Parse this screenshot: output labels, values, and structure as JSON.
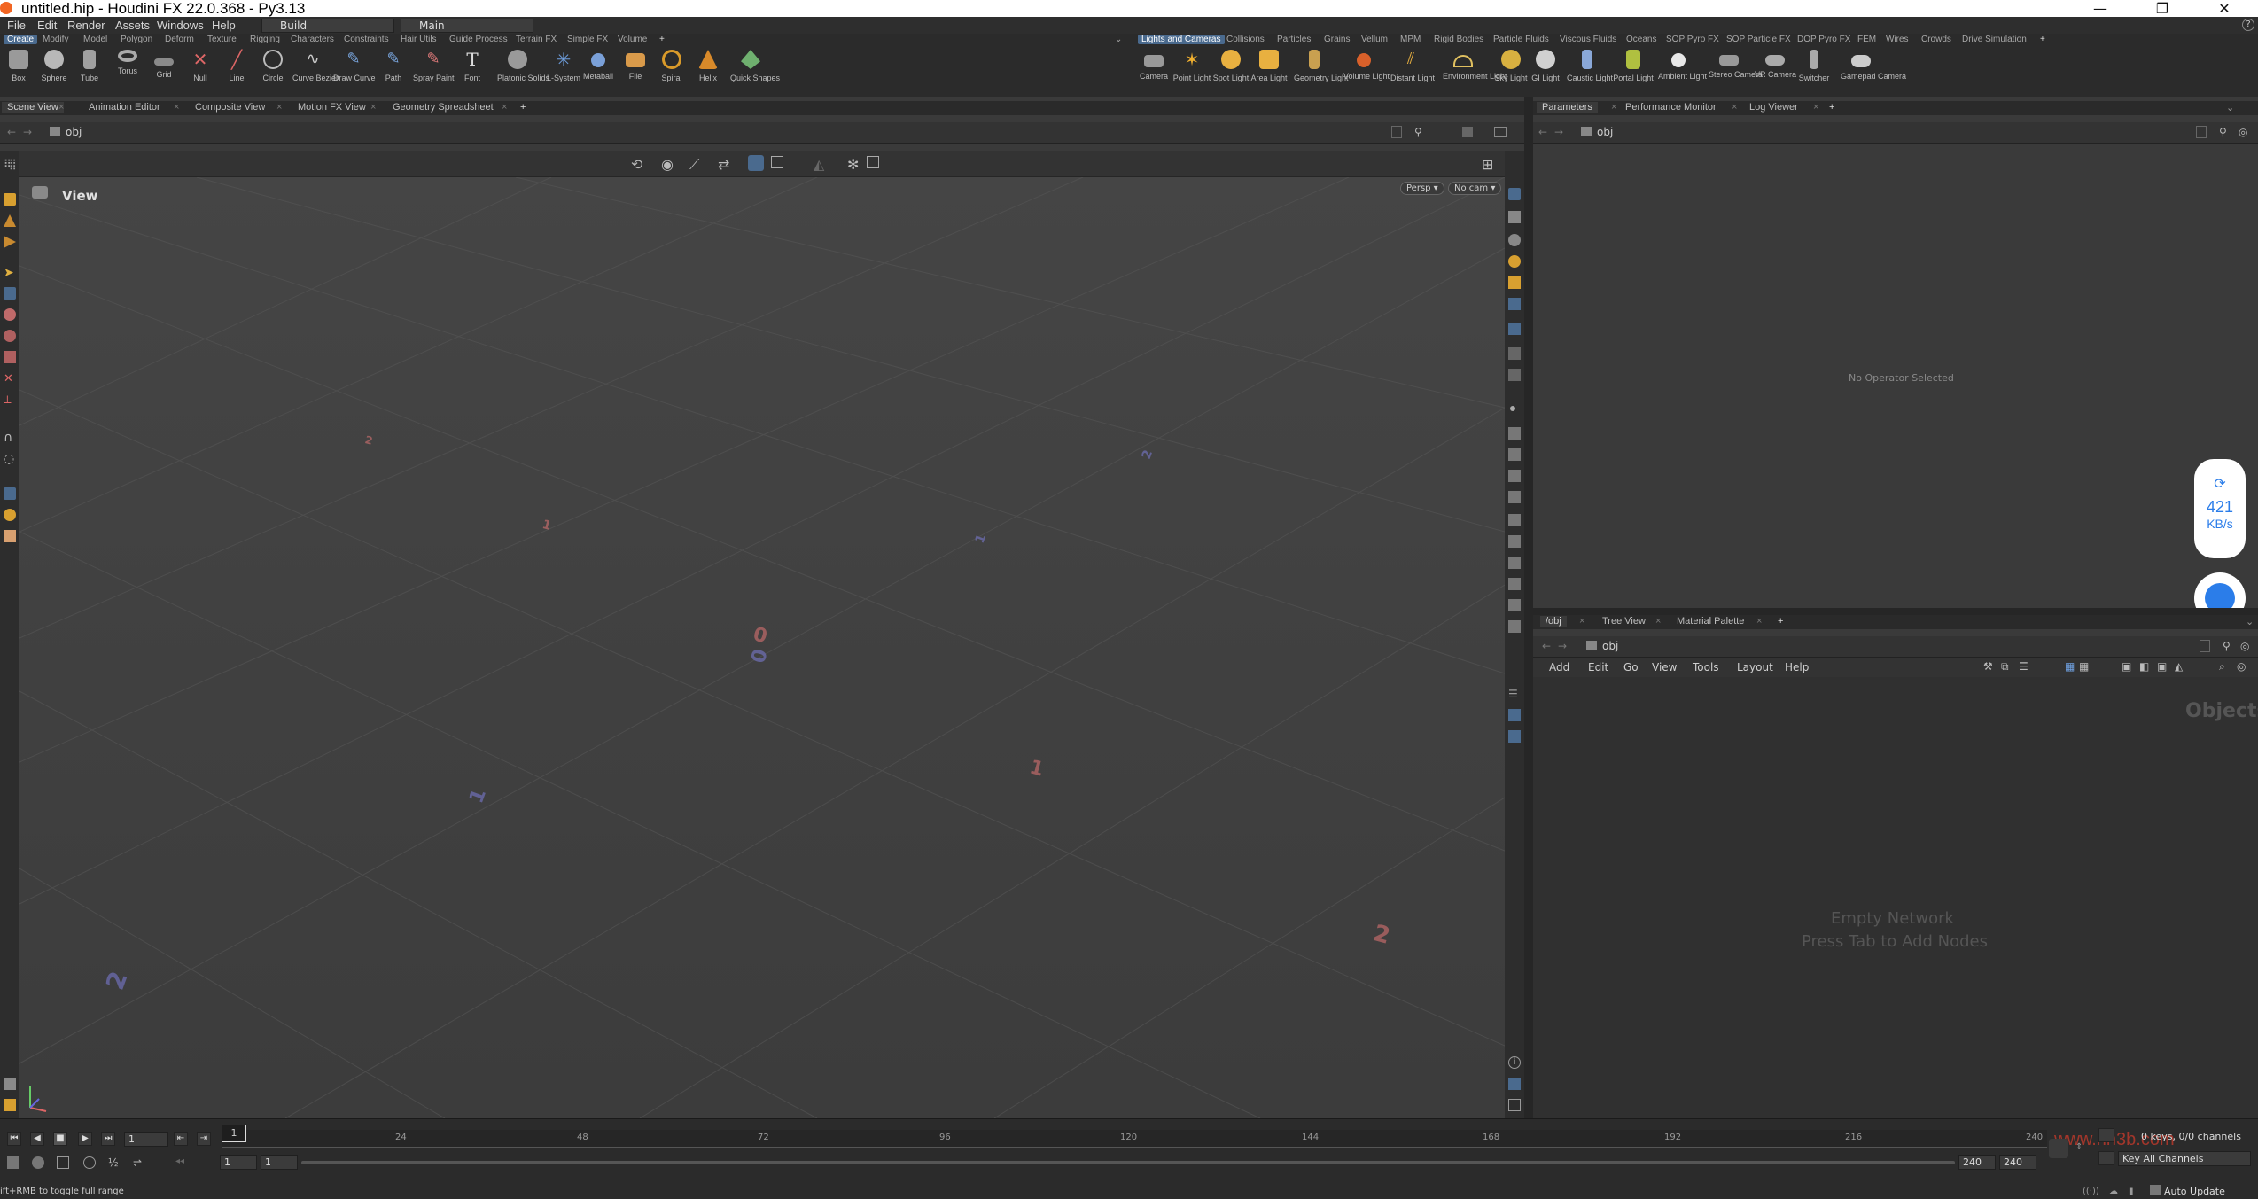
{
  "window": {
    "title": "untitled.hip - Houdini FX 22.0.368 - Py3.13",
    "controls": [
      "—",
      "❐",
      "✕"
    ]
  },
  "menubar": {
    "items": [
      "File",
      "Edit",
      "Render",
      "Assets",
      "Windows",
      "Help"
    ],
    "desktop_combo": "Build",
    "context_combo": "Main"
  },
  "shelf_left": {
    "tabs": [
      "Create",
      "Modify",
      "Model",
      "Polygon",
      "Deform",
      "Texture",
      "Rigging",
      "Characters",
      "Hair Utils",
      "Guide Process",
      "Terrain FX",
      "Simple FX",
      "Volume"
    ],
    "active_tab": "Create",
    "tools": [
      "Box",
      "Sphere",
      "Tube",
      "Torus",
      "Grid",
      "Null",
      "Line",
      "Circle",
      "Curve Bezier",
      "Draw Curve",
      "Path",
      "Spray Paint",
      "Font",
      "Platonic Solids",
      "L-System",
      "Metaball",
      "File",
      "Spiral",
      "Helix",
      "Quick Shapes"
    ]
  },
  "shelf_right": {
    "tabs": [
      "Lights and Cameras",
      "Collisions",
      "Particles",
      "Grains",
      "Vellum",
      "MPM",
      "Rigid Bodies",
      "Particle Fluids",
      "Viscous Fluids",
      "Oceans",
      "SOP Pyro FX",
      "SOP Particle FX",
      "DOP Pyro FX",
      "FEM",
      "Wires",
      "Crowds",
      "Drive Simulation"
    ],
    "active_tab": "Lights and Cameras",
    "tools": [
      "Camera",
      "Point Light",
      "Spot Light",
      "Area Light",
      "Geometry Light",
      "Volume Light",
      "Distant Light",
      "Environment Light",
      "Sky Light",
      "GI Light",
      "Caustic Light",
      "Portal Light",
      "Ambient Light",
      "Stereo Camera",
      "VR Camera",
      "Switcher",
      "Gamepad Camera"
    ]
  },
  "left_pane": {
    "tabs": [
      "Scene View",
      "Animation Editor",
      "Composite View",
      "Motion FX View",
      "Geometry Spreadsheet"
    ],
    "path": "obj",
    "view_label": "View",
    "persp": "Persp ▾",
    "cam": "No cam ▾",
    "grid_numbers": [
      {
        "t": "0",
        "c": "#c06a6a"
      },
      {
        "t": "0",
        "c": "#7070b8"
      },
      {
        "t": "1",
        "c": "#c06a6a"
      },
      {
        "t": "1",
        "c": "#7070b8"
      },
      {
        "t": "2",
        "c": "#c06a6a"
      },
      {
        "t": "2",
        "c": "#7070b8"
      },
      {
        "t": "1",
        "c": "#c06a6a"
      },
      {
        "t": "1",
        "c": "#7070b8"
      },
      {
        "t": "2",
        "c": "#c06a6a"
      },
      {
        "t": "2",
        "c": "#7070b8"
      }
    ]
  },
  "params_pane": {
    "tabs": [
      "Parameters",
      "Performance Monitor",
      "Log Viewer"
    ],
    "path": "obj",
    "empty_text": "No Operator Selected"
  },
  "net_pane": {
    "tabs": [
      "/obj",
      "Tree View",
      "Material Palette"
    ],
    "path": "obj",
    "menu": [
      "Add",
      "Edit",
      "Go",
      "View",
      "Tools",
      "Layout",
      "Help"
    ],
    "context_title": "Objects",
    "empty_line1": "Empty Network",
    "empty_line2": "Press Tab to Add Nodes"
  },
  "float_widget": {
    "speed": "421",
    "unit": "KB/s"
  },
  "timeline": {
    "current_frame": "1",
    "playhead": "1",
    "ticks": [
      "24",
      "48",
      "72",
      "96",
      "120",
      "144",
      "168",
      "192",
      "216",
      "240"
    ],
    "start1": "1",
    "start2": "1",
    "end1": "240",
    "end2": "240",
    "keys_info": "0 keys, 0/0 channels",
    "key_all": "Key All Channels",
    "auto_update": "Auto Update",
    "status": "ift+RMB to toggle full range",
    "watermark": "www.hh3b.com"
  },
  "colors": {
    "accent": "#4a6a8e",
    "axis_x": "#c06a6a",
    "axis_z": "#7070b8",
    "logo": "#f26522"
  }
}
